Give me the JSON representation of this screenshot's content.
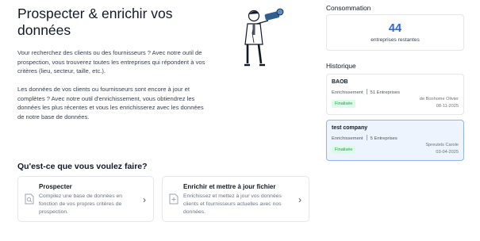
{
  "main": {
    "title": "Prospecter & enrichir vos données",
    "intro": [
      "Vour recherchez des clients ou des fournisseurs ? Avec notre outil de prospection, vous trouverez toutes les entreprises qui répondent à vos critères (lieu, secteur, taille, etc.).",
      "Les données de vos clients ou fournisseurs sont encore à jour et complètes ? Avec notre outil d'enrichissement, vous obtiendrez les données les plus récentes et vous les enrichisserez avec les données de notre base de données."
    ],
    "question": "Qu'est-ce que vous voulez faire?",
    "actions": [
      {
        "title": "Prospecter",
        "description": "Compilez une base de données en fonction de vos propres critères de prospection.",
        "icon": "document-search-icon"
      },
      {
        "title": "Enrichir et mettre à jour fichier",
        "description": "Enrichissez et mettez à jour vos données clients et fournisseurs actuelles avec nos données.",
        "icon": "document-add-icon"
      }
    ]
  },
  "sidebar": {
    "consumption_label": "Consommation",
    "remaining_count": "44",
    "remaining_text": "entreprises restantes",
    "history_label": "Historique",
    "history": [
      {
        "name": "BAOB",
        "type": "Enrichissement",
        "count": "51 Entreprises",
        "status": "Finalisée",
        "user": "de Bonhome Olivier",
        "date": "08-11-2025"
      },
      {
        "name": "test company",
        "type": "Enrichissement",
        "count": "5 Entreprises",
        "status": "Finalisée",
        "user": "Spreutels Carole",
        "date": "03-04-2025"
      }
    ]
  },
  "colors": {
    "accent": "#2563eb",
    "success": "#16a34a",
    "selected_bg": "#eef4fd"
  }
}
